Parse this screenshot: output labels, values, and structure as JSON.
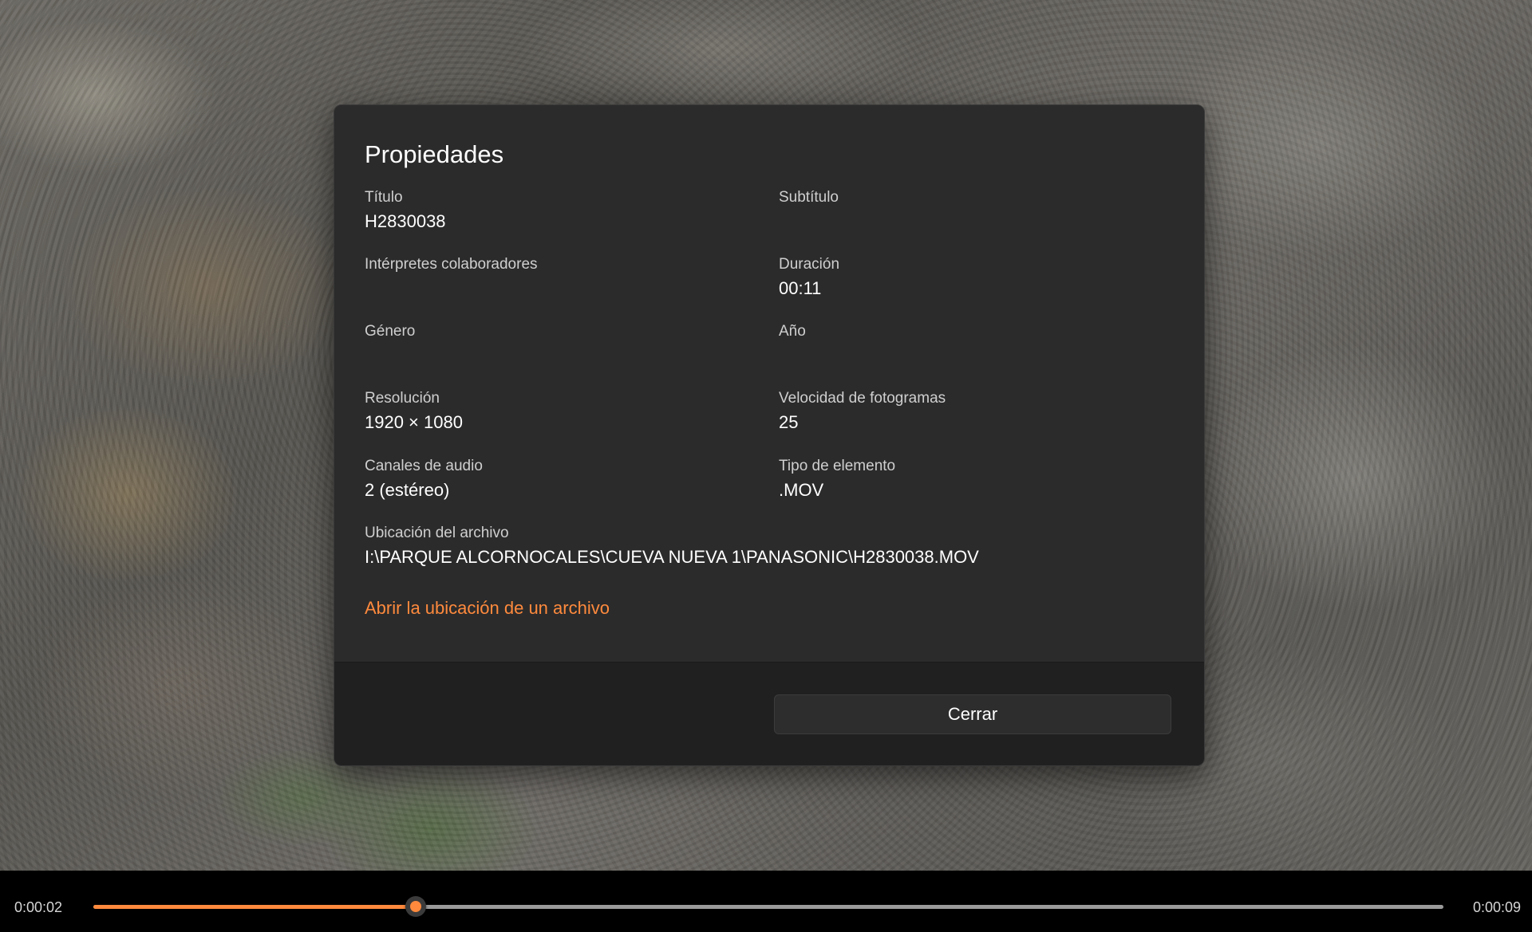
{
  "dialog": {
    "title": "Propiedades",
    "properties": {
      "title": {
        "label": "Título",
        "value": "H2830038"
      },
      "subtitle": {
        "label": "Subtítulo",
        "value": ""
      },
      "contributing_artists": {
        "label": "Intérpretes colaboradores",
        "value": ""
      },
      "duration": {
        "label": "Duración",
        "value": "00:11"
      },
      "genre": {
        "label": "Género",
        "value": ""
      },
      "year": {
        "label": "Año",
        "value": ""
      },
      "resolution": {
        "label": "Resolución",
        "value": "1920 × 1080"
      },
      "frame_rate": {
        "label": "Velocidad de fotogramas",
        "value": "25"
      },
      "audio_channels": {
        "label": "Canales de audio",
        "value": "2 (estéreo)"
      },
      "item_type": {
        "label": "Tipo de elemento",
        "value": ".MOV"
      },
      "file_location": {
        "label": "Ubicación del archivo",
        "value": "I:\\PARQUE ALCORNOCALES\\CUEVA NUEVA 1\\PANASONIC\\H2830038.MOV"
      }
    },
    "open_location_link": "Abrir la ubicación de un archivo",
    "close_button": "Cerrar"
  },
  "player": {
    "current_time": "0:00:02",
    "total_time": "0:00:09",
    "progress_fraction": 0.239
  },
  "colors": {
    "accent": "#ff8a3d",
    "dialog_background": "#2b2b2b",
    "footer_background": "#202020",
    "player_bar": "#000000"
  }
}
